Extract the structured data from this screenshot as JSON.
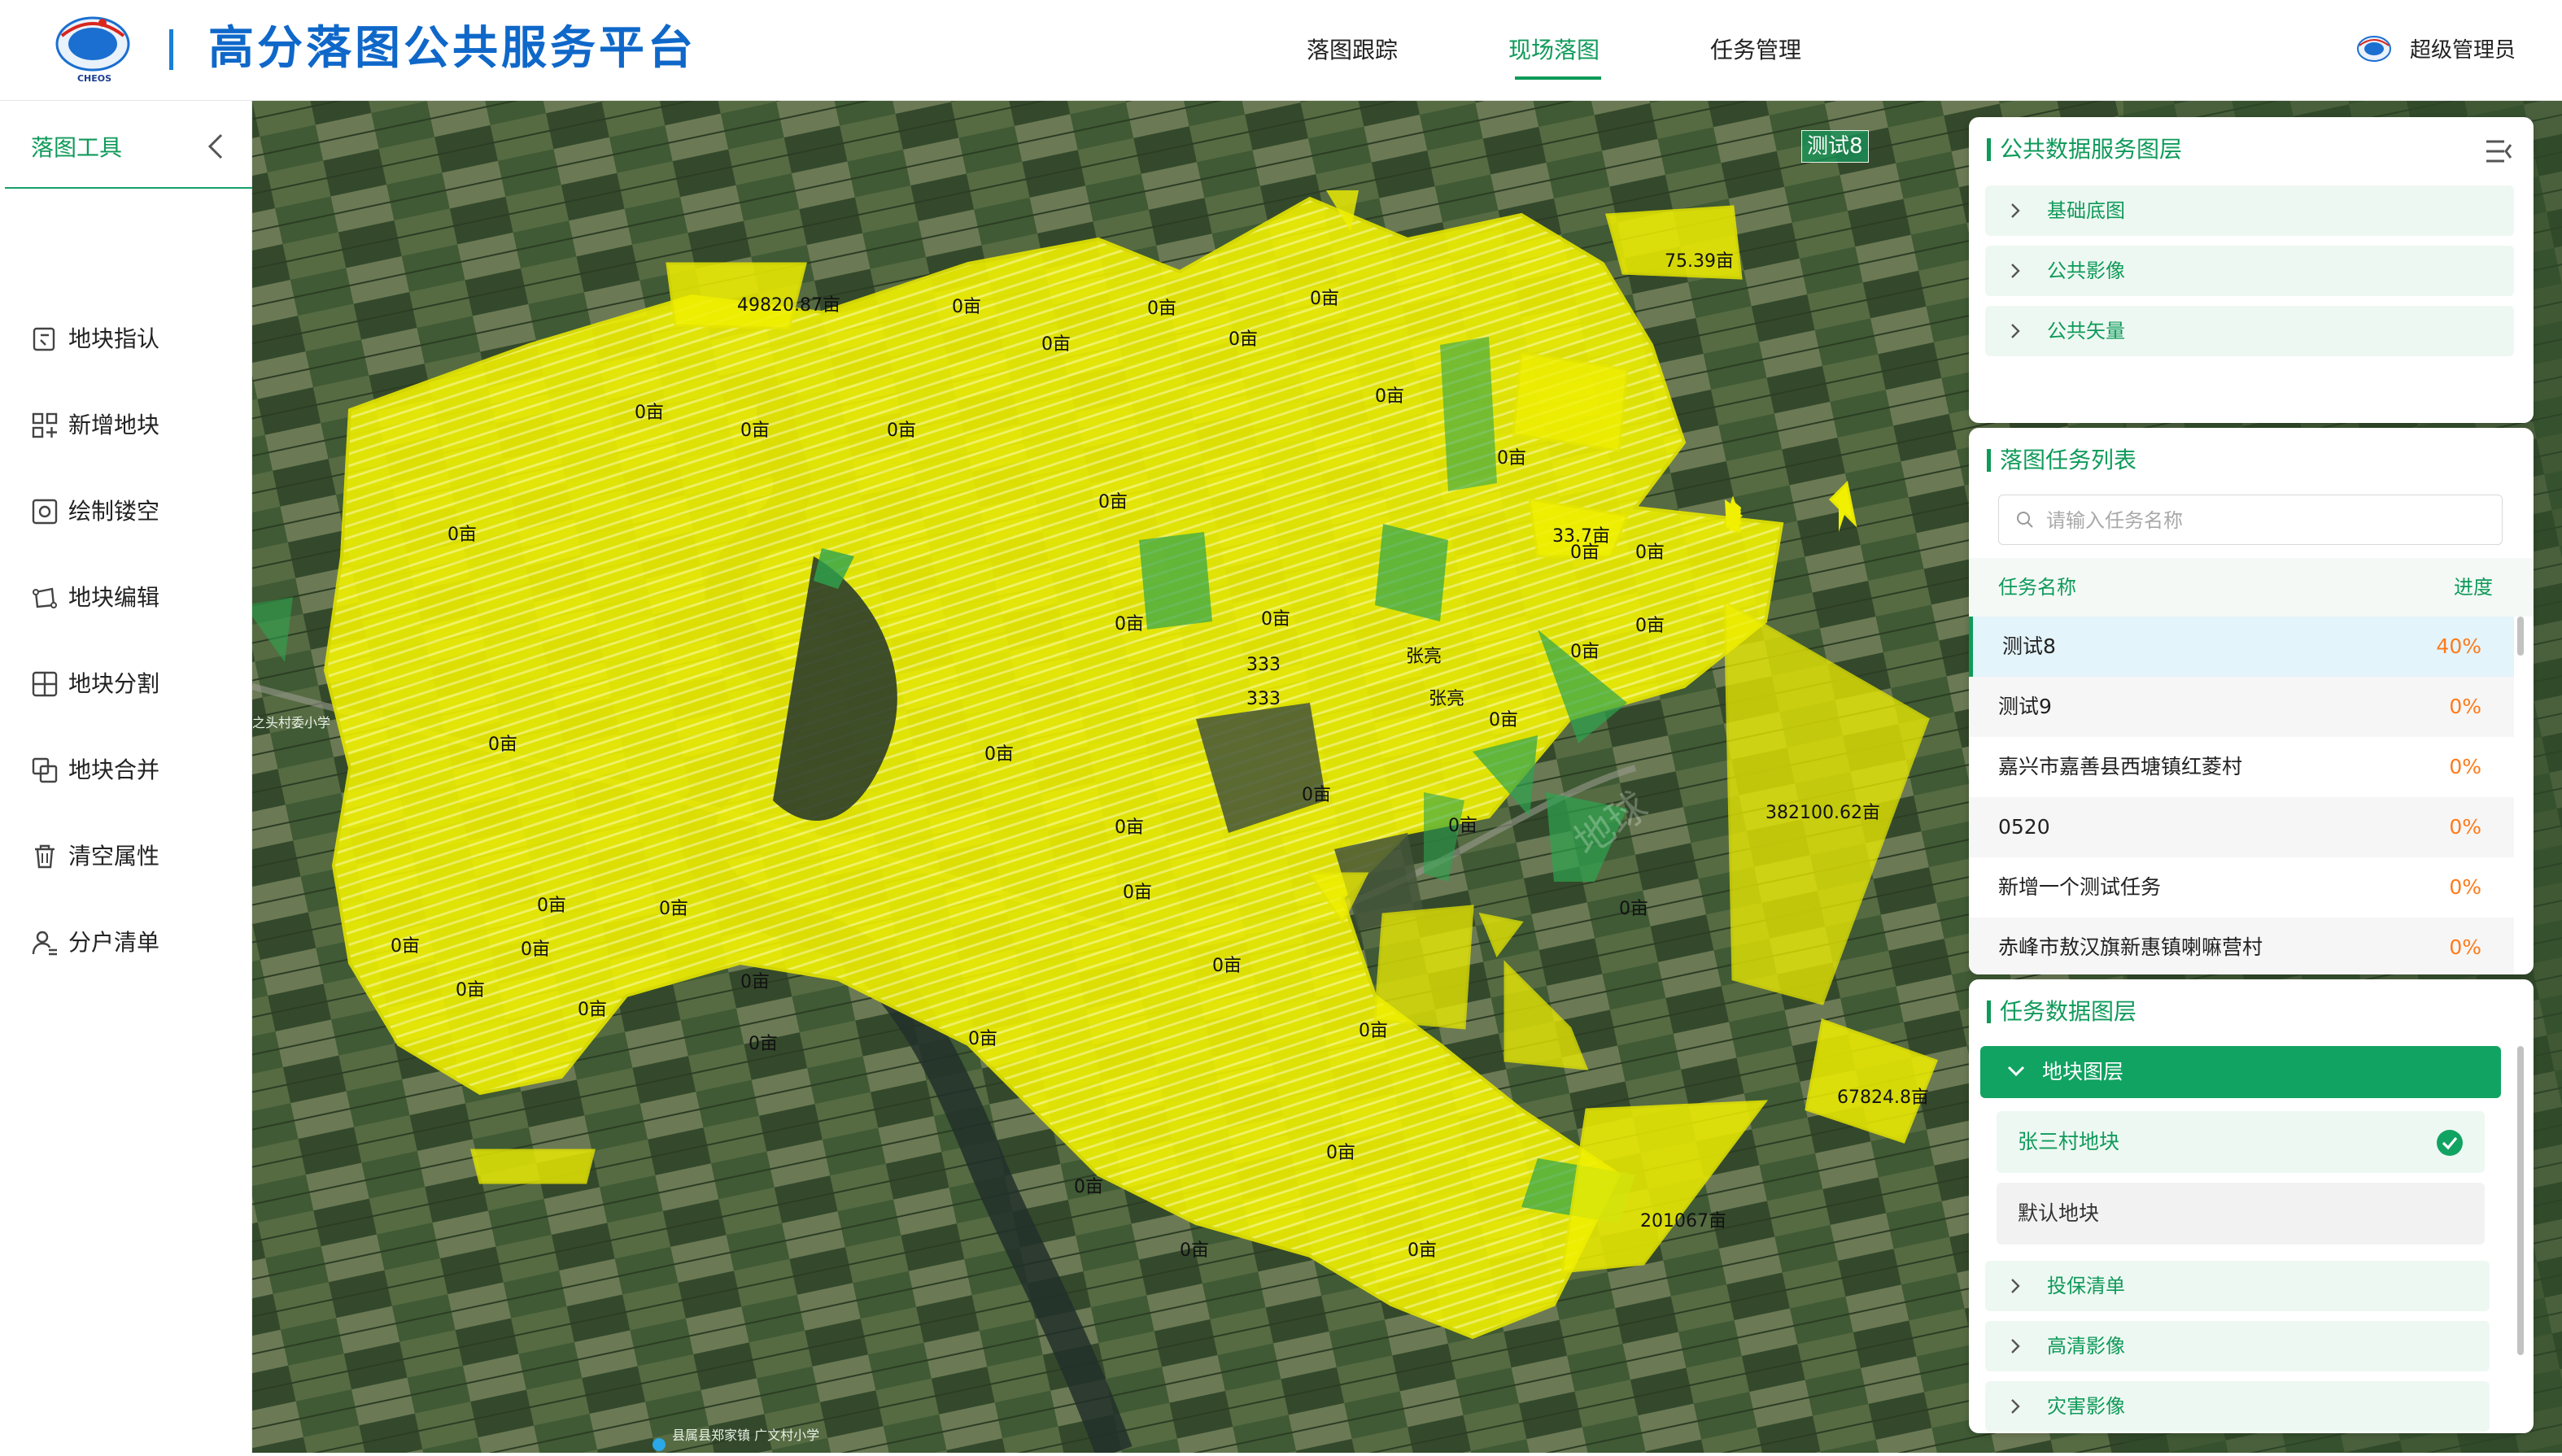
{
  "app": {
    "title": "高分落图公共服务平台",
    "logo_text": "中国高分用测 CHEOS"
  },
  "nav": {
    "tabs": [
      "落图跟踪",
      "现场落图",
      "任务管理"
    ],
    "active_tab": "现场落图"
  },
  "user": {
    "name": "超级管理员"
  },
  "sidebar": {
    "title": "落图工具",
    "tools": [
      {
        "label": "地块指认",
        "icon": "locate-plot-icon"
      },
      {
        "label": "新增地块",
        "icon": "add-plot-icon"
      },
      {
        "label": "绘制镂空",
        "icon": "draw-hole-icon"
      },
      {
        "label": "地块编辑",
        "icon": "edit-plot-icon"
      },
      {
        "label": "地块分割",
        "icon": "split-plot-icon"
      },
      {
        "label": "地块合并",
        "icon": "merge-plot-icon"
      },
      {
        "label": "清空属性",
        "icon": "trash-icon"
      },
      {
        "label": "分户清单",
        "icon": "user-list-icon"
      }
    ]
  },
  "map": {
    "task_tag": "测试8",
    "plot_labels": [
      "49820.87亩",
      "75.39亩",
      "33.7亩",
      "382100.62亩",
      "67824.8亩",
      "201067亩",
      "0亩",
      "333",
      "张亮"
    ],
    "place_labels": [
      "之头村委小学",
      "县属县郑家镇 广文村小学"
    ],
    "watermark": "地球"
  },
  "public_layers": {
    "title": "公共数据服务图层",
    "items": [
      "基础底图",
      "公共影像",
      "公共矢量"
    ]
  },
  "task_list": {
    "title": "落图任务列表",
    "search_placeholder": "请输入任务名称",
    "col_name": "任务名称",
    "col_progress": "进度",
    "rows": [
      {
        "name": "测试8",
        "progress": "40%"
      },
      {
        "name": "测试9",
        "progress": "0%"
      },
      {
        "name": "嘉兴市嘉善县西塘镇红菱村",
        "progress": "0%"
      },
      {
        "name": "0520",
        "progress": "0%"
      },
      {
        "name": "新增一个测试任务",
        "progress": "0%"
      },
      {
        "name": "赤峰市敖汉旗新惠镇喇嘛营村",
        "progress": "0%"
      }
    ],
    "selected": "测试8"
  },
  "task_layers": {
    "title": "任务数据图层",
    "plot_layer_label": "地块图层",
    "plot_layers": [
      {
        "label": "张三村地块",
        "checked": true
      },
      {
        "label": "默认地块",
        "checked": false
      }
    ],
    "other_layers": [
      "投保清单",
      "高清影像",
      "灾害影像"
    ]
  },
  "colors": {
    "accent": "#0f9a5a",
    "title_blue": "#0f68c9",
    "progress_orange": "#ff7a1a",
    "plot_fill": "#f2f20a",
    "plot_stroke": "#e6e600",
    "green_plot": "#2ea44f"
  }
}
